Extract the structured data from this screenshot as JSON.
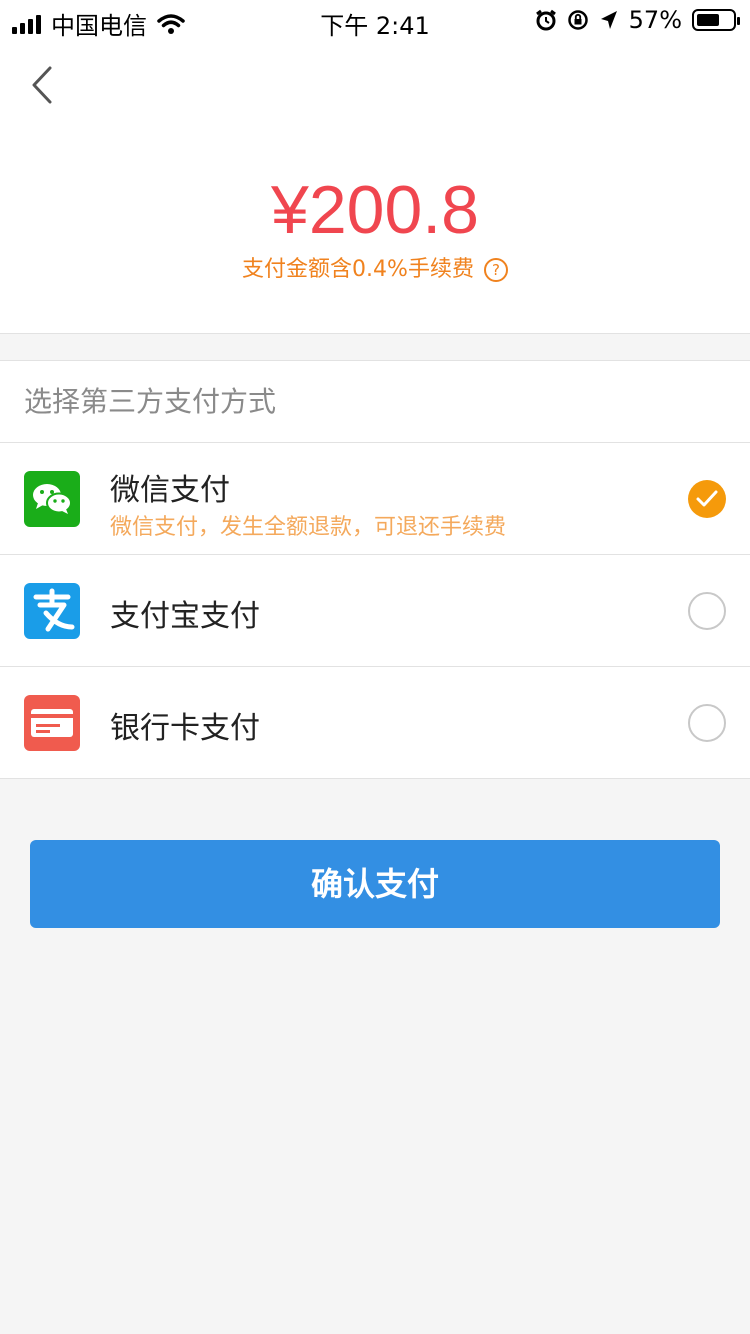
{
  "status_bar": {
    "carrier": "中国电信",
    "time": "下午 2:41",
    "battery": "57%",
    "battery_level": 0.57
  },
  "header": {
    "amount": "¥200.8",
    "fee_note": "支付金额含0.4%手续费",
    "help_symbol": "?"
  },
  "methods_section": {
    "title": "选择第三方支付方式",
    "methods": [
      {
        "label": "微信支付",
        "subtitle": "微信支付，发生全额退款，可退还手续费",
        "icon": "wechat-icon",
        "color": "#1aad19",
        "selected": true
      },
      {
        "label": "支付宝支付",
        "icon": "alipay-icon",
        "color": "#1a9de8",
        "selected": false
      },
      {
        "label": "银行卡支付",
        "icon": "bank-card-icon",
        "color": "#f05b4e",
        "selected": false
      }
    ]
  },
  "confirm_button": {
    "label": "确认支付",
    "color": "#338fe3"
  },
  "colors": {
    "amount": "#f0464f",
    "fee_note": "#f0821e",
    "selected_radio": "#f59a0b"
  }
}
